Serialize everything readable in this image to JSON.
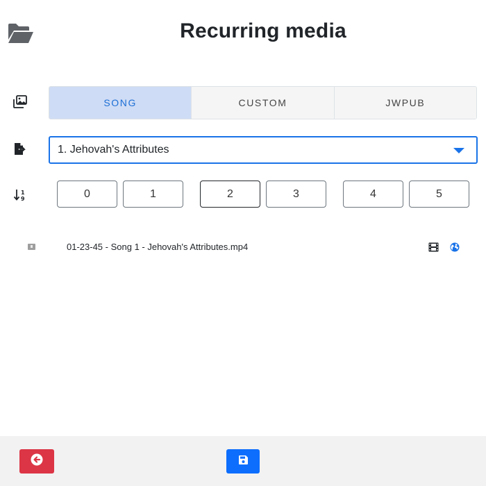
{
  "header": {
    "title": "Recurring media",
    "icon": "folder-open-icon"
  },
  "type_tabs": {
    "icon": "images-icon",
    "items": [
      {
        "label": "SONG",
        "active": true
      },
      {
        "label": "CUSTOM",
        "active": false
      },
      {
        "label": "JWPUB",
        "active": false
      }
    ]
  },
  "song_select": {
    "icon": "file-export-icon",
    "value": "1. Jehovah's Attributes"
  },
  "sort_buttons": {
    "icon": "sort-numeric-icon",
    "items": [
      "0",
      "1",
      "2",
      "3",
      "4",
      "5"
    ]
  },
  "media_list": [
    {
      "filename": "01-23-45 - Song 1 - Jehovah's Attributes.mp4",
      "type_icon": "film-icon",
      "source_icon": "globe-icon"
    }
  ],
  "footer": {
    "back_icon": "arrow-circle-left-icon",
    "save_icon": "save-icon"
  },
  "colors": {
    "accent": "#1a73e8",
    "active_tab_bg": "#cfdcf5",
    "danger": "#dc3545",
    "primary": "#0d6efd",
    "footer_bg": "#f2f2f2"
  }
}
